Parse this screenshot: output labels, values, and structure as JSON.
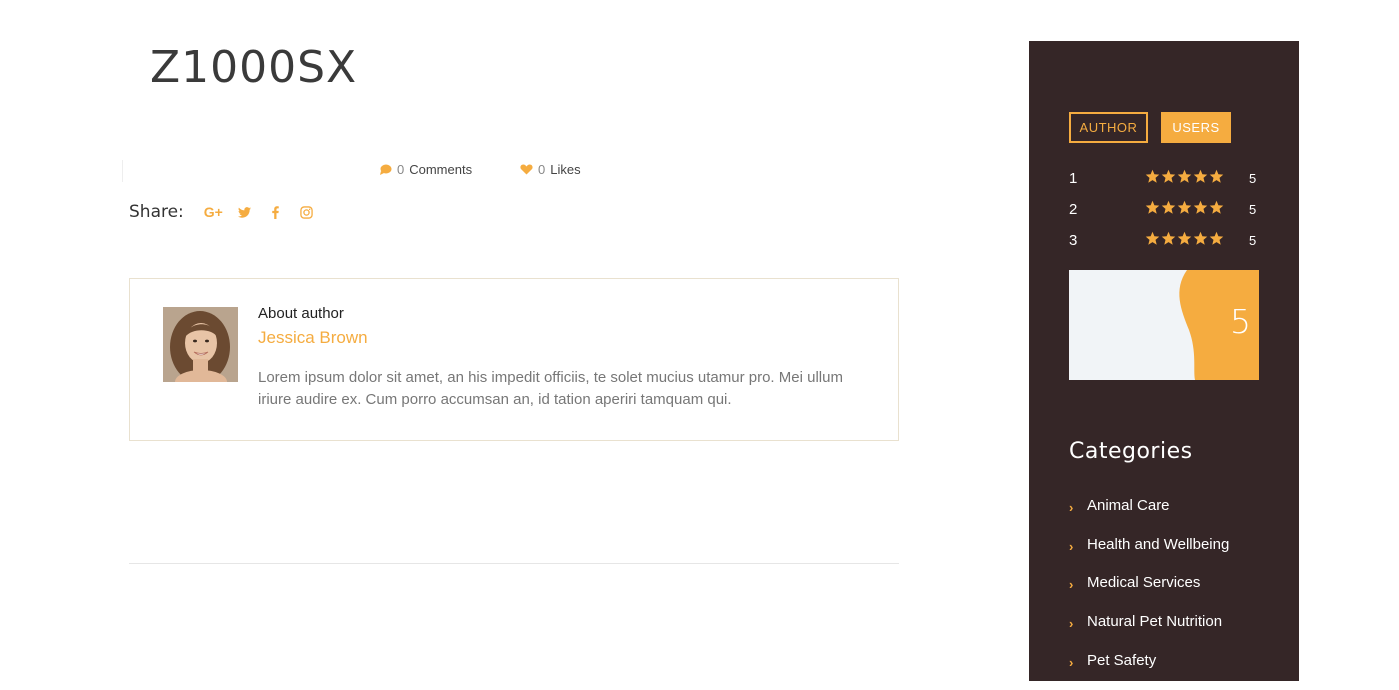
{
  "post": {
    "title": "Z1000SX",
    "comments_count": "0",
    "comments_label": "Comments",
    "likes_count": "0",
    "likes_label": "Likes"
  },
  "share": {
    "label": "Share:",
    "icons": [
      "google-plus-icon",
      "twitter-icon",
      "facebook-icon",
      "instagram-icon"
    ]
  },
  "author": {
    "about_label": "About author",
    "name": "Jessica Brown",
    "bio": "Lorem ipsum dolor sit amet, an his impedit officiis, te solet mucius utamur pro. Mei ullum iriure audire ex. Cum porro accumsan an, id tation aperiri tamquam qui."
  },
  "sidebar": {
    "tabs": {
      "author": "AUTHOR",
      "users": "USERS",
      "active": "USERS"
    },
    "ratings": [
      {
        "rank": "1",
        "stars": 5,
        "score": "5"
      },
      {
        "rank": "2",
        "stars": 5,
        "score": "5"
      },
      {
        "rank": "3",
        "stars": 5,
        "score": "5"
      }
    ],
    "overall_score": "5",
    "categories_title": "Categories",
    "categories": [
      "Animal Care",
      "Health and Wellbeing",
      "Medical Services",
      "Natural Pet Nutrition",
      "Pet Safety"
    ]
  },
  "colors": {
    "accent": "#f5ac40",
    "sidebar_bg": "#352627",
    "score_card_bg": "#f1f4f7",
    "text_dark": "#333333",
    "text_muted": "#777777"
  }
}
